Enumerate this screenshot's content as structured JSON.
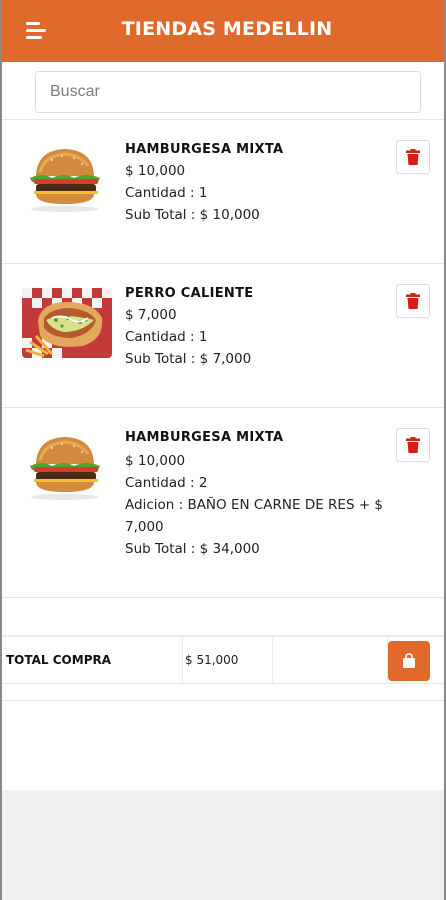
{
  "header": {
    "title": "TIENDAS MEDELLIN",
    "menu_icon": "hamburger-menu-icon",
    "color": "#e06a2c"
  },
  "search": {
    "placeholder": "Buscar",
    "value": ""
  },
  "cart": {
    "items": [
      {
        "name": "HAMBURGESA MIXTA",
        "price": "$ 10,000",
        "quantity": "Cantidad : 1",
        "subtotal": "Sub Total : $ 10,000",
        "image": "burger-image"
      },
      {
        "name": "PERRO CALIENTE",
        "price": "$ 7,000",
        "quantity": "Cantidad : 1",
        "subtotal": "Sub Total : $ 7,000",
        "image": "hotdog-image"
      },
      {
        "name": "HAMBURGESA MIXTA",
        "price": "$ 10,000",
        "quantity": "Cantidad : 2",
        "addition": "Adicion : BAÑO EN CARNE DE RES + $ 7,000",
        "subtotal": "Sub Total : $ 34,000",
        "image": "burger-image"
      }
    ],
    "delete_icon": "trash-icon",
    "delete_color": "#d81b1b"
  },
  "total": {
    "label": "TOTAL COMPRA",
    "value": "$ 51,000",
    "checkout_icon": "shopping-bag-icon"
  }
}
